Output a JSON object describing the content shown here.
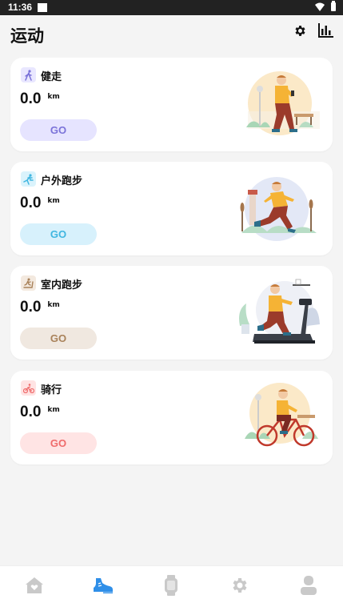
{
  "status_bar": {
    "time": "11:36"
  },
  "header": {
    "title": "运动",
    "settings_icon": "gear-icon",
    "stats_icon": "bar-chart-icon"
  },
  "cards": [
    {
      "name": "健走",
      "distance": "0.0",
      "unit": "km",
      "go": "GO",
      "icon": "walking-icon",
      "accent": "#7b73d9",
      "icon_bg": "#e9e7ff",
      "btn_bg": "#e6e4ff"
    },
    {
      "name": "户外跑步",
      "distance": "0.0",
      "unit": "km",
      "go": "GO",
      "icon": "running-icon",
      "accent": "#3fb6e0",
      "icon_bg": "#daf3fc",
      "btn_bg": "#d7f1fc"
    },
    {
      "name": "室内跑步",
      "distance": "0.0",
      "unit": "km",
      "go": "GO",
      "icon": "treadmill-icon",
      "accent": "#a9825a",
      "icon_bg": "#f3e9df",
      "btn_bg": "#f0e8e0"
    },
    {
      "name": "骑行",
      "distance": "0.0",
      "unit": "km",
      "go": "GO",
      "icon": "cycling-icon",
      "accent": "#ef6b6b",
      "icon_bg": "#ffe3e3",
      "btn_bg": "#ffe4e4"
    }
  ],
  "bottom_nav": {
    "items": [
      {
        "icon": "home-icon",
        "active": false
      },
      {
        "icon": "running-shoe-icon",
        "active": true
      },
      {
        "icon": "watch-icon",
        "active": false
      },
      {
        "icon": "gear-icon",
        "active": false
      },
      {
        "icon": "profile-icon",
        "active": false
      }
    ],
    "active_color": "#2f8fe8",
    "inactive_color": "#c9c9c9"
  }
}
